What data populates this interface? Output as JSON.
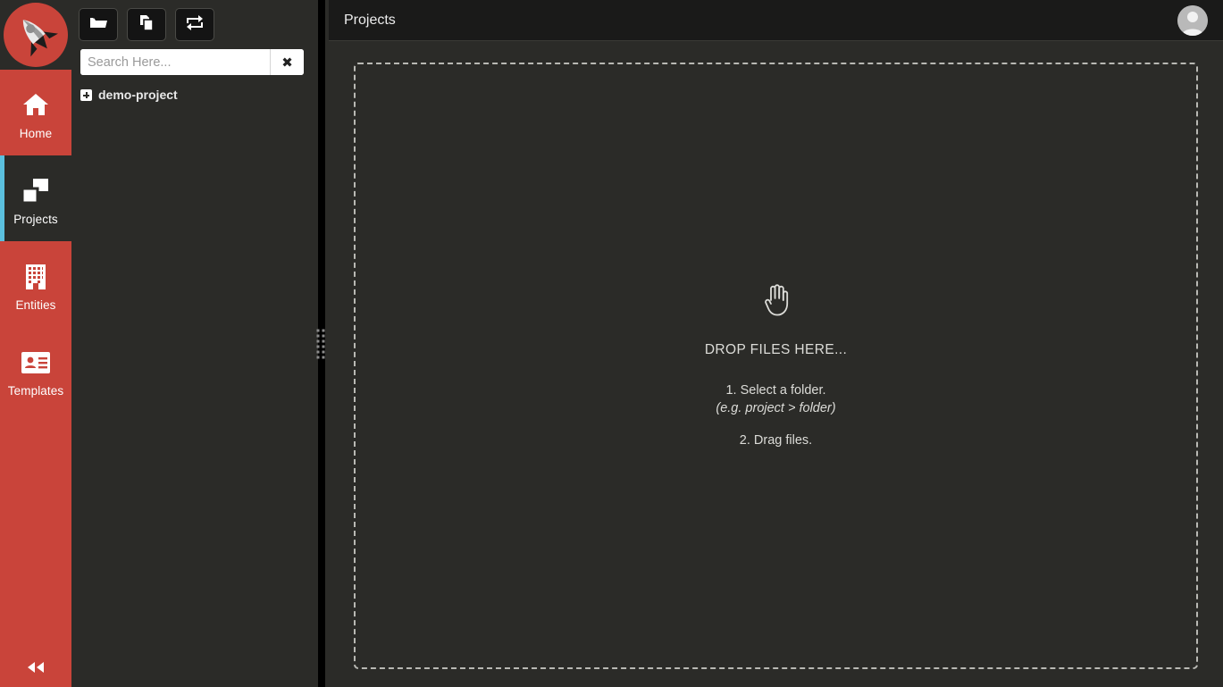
{
  "app": {
    "logo_icon": "rocket-logo-icon",
    "accent_red": "#c9443a",
    "accent_blue": "#5bc0de",
    "panel_bg": "#2b2b28",
    "header_bg": "#1a1a19"
  },
  "rail": {
    "items": [
      {
        "label": "Home",
        "icon": "home-icon",
        "active": false
      },
      {
        "label": "Projects",
        "icon": "projects-icon",
        "active": true
      },
      {
        "label": "Entities",
        "icon": "entities-icon",
        "active": false
      },
      {
        "label": "Templates",
        "icon": "templates-icon",
        "active": false
      }
    ],
    "collapse_icon": "double-chevron-left-icon"
  },
  "tree_panel": {
    "toolbar": [
      {
        "name": "open-folder-button",
        "icon": "open-folder-icon"
      },
      {
        "name": "copy-files-button",
        "icon": "copy-pages-icon"
      },
      {
        "name": "refresh-sync-button",
        "icon": "sync-arrows-icon"
      }
    ],
    "search": {
      "value": "",
      "placeholder": "Search Here...",
      "clear_label": "✖"
    },
    "tree": [
      {
        "label": "demo-project",
        "expandable": true,
        "expanded": false
      }
    ]
  },
  "splitter": {
    "name": "panel-resize-handle"
  },
  "header": {
    "title": "Projects",
    "avatar_icon": "user-avatar-icon"
  },
  "dropzone": {
    "icon": "open-hand-icon",
    "title": "DROP FILES HERE...",
    "step1": "1. Select a folder.",
    "hint": "(e.g. project > folder)",
    "step2": "2. Drag files."
  }
}
